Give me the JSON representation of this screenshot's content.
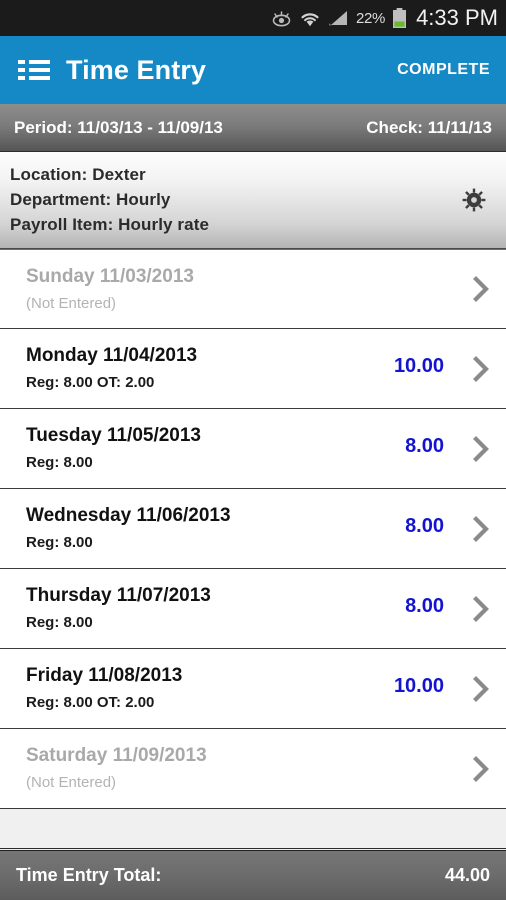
{
  "statusbar": {
    "icons": [
      "smart-stay-eye-icon",
      "wifi-icon",
      "signal-icon",
      "battery-icon"
    ],
    "battery_percent": "22%",
    "time": "4:33 PM"
  },
  "actionbar": {
    "menu_icon": "list-menu-icon",
    "title": "Time Entry",
    "action_label": "COMPLETE",
    "background_color": "#1589c6"
  },
  "periodbar": {
    "period_label": "Period: 11/03/13 - 11/09/13",
    "check_label": "Check: 11/11/13"
  },
  "infopanel": {
    "location": "Location: Dexter",
    "department": "Department: Hourly",
    "payroll_item": "Payroll Item: Hourly rate",
    "settings_icon": "gear-icon"
  },
  "list": {
    "rows": [
      {
        "day": "Sunday 11/03/2013",
        "sub": "(Not Entered)",
        "total": "",
        "entered": false
      },
      {
        "day": "Monday 11/04/2013",
        "sub": "Reg: 8.00 OT: 2.00",
        "total": "10.00",
        "entered": true
      },
      {
        "day": "Tuesday 11/05/2013",
        "sub": "Reg: 8.00",
        "total": "8.00",
        "entered": true
      },
      {
        "day": "Wednesday 11/06/2013",
        "sub": "Reg: 8.00",
        "total": "8.00",
        "entered": true
      },
      {
        "day": "Thursday 11/07/2013",
        "sub": "Reg: 8.00",
        "total": "8.00",
        "entered": true
      },
      {
        "day": "Friday 11/08/2013",
        "sub": "Reg: 8.00 OT: 2.00",
        "total": "10.00",
        "entered": true
      },
      {
        "day": "Saturday 11/09/2013",
        "sub": "(Not Entered)",
        "total": "",
        "entered": false
      }
    ],
    "chevron_icon": "chevron-right-icon",
    "value_color": "#1414cf"
  },
  "totalbar": {
    "label": "Time Entry Total:",
    "value": "44.00"
  }
}
